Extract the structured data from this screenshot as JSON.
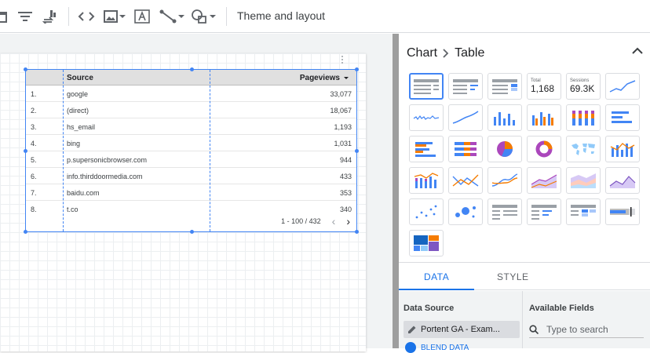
{
  "toolbar": {
    "theme_label": "Theme and layout",
    "icons": [
      "calendar-icon",
      "filter-icon",
      "data-control-icon",
      "code-icon",
      "image-icon",
      "text-icon",
      "line-icon",
      "shape-icon"
    ]
  },
  "table": {
    "columns": [
      "Source",
      "Pageviews"
    ],
    "rows": [
      {
        "n": "1.",
        "source": "google",
        "pageviews": "33,077"
      },
      {
        "n": "2.",
        "source": "(direct)",
        "pageviews": "18,067"
      },
      {
        "n": "3.",
        "source": "hs_email",
        "pageviews": "1,193"
      },
      {
        "n": "4.",
        "source": "bing",
        "pageviews": "1,031"
      },
      {
        "n": "5.",
        "source": "p.supersonicbrowser.com",
        "pageviews": "944"
      },
      {
        "n": "6.",
        "source": "info.thirddoormedia.com",
        "pageviews": "433"
      },
      {
        "n": "7.",
        "source": "baidu.com",
        "pageviews": "353"
      },
      {
        "n": "8.",
        "source": "t.co",
        "pageviews": "340"
      }
    ],
    "pagination": "1 - 100 / 432"
  },
  "panel": {
    "breadcrumb_parent": "Chart",
    "breadcrumb_current": "Table",
    "scorecard_total_label": "Total",
    "scorecard_total_value": "1,168",
    "scorecard_sessions_label": "Sessions",
    "scorecard_sessions_value": "69.3K",
    "tabs": [
      "DATA",
      "STYLE"
    ],
    "data_source_title": "Data Source",
    "data_source_name": "Portent GA - Exam...",
    "blend_label": "BLEND DATA",
    "available_fields_title": "Available Fields",
    "search_placeholder": "Type to search"
  },
  "colors": {
    "accent": "#4285f4",
    "orange": "#f57c00",
    "purple": "#ab47bc",
    "selection": "#4285f4"
  }
}
